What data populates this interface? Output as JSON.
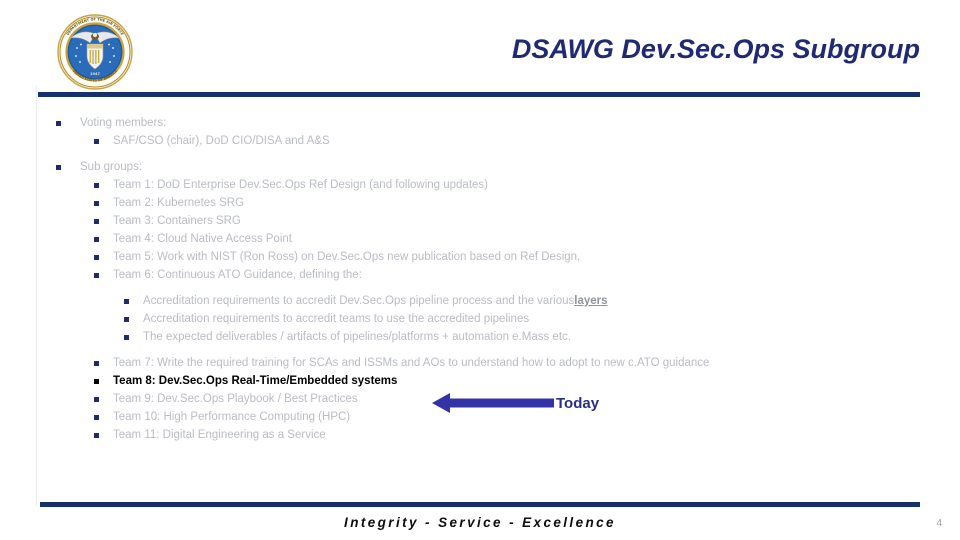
{
  "slide": {
    "title": "DSAWG Dev.Sec.Ops Subgroup",
    "page_number": "4",
    "footer_tagline": "Integrity - Service - Excellence",
    "accent_navy": "#17306e",
    "title_color": "#1f2a72",
    "body_gray": "#b9bcc4",
    "arrow_blue": "#3333a8"
  },
  "seal": {
    "name": "department-of-the-air-force-seal",
    "ring_text_top": "DEPARTMENT OF THE",
    "ring_text_bottom": "AIR FORCE",
    "ring_date": "1947"
  },
  "content": {
    "bullets": [
      {
        "level": 1,
        "text": "Voting members:",
        "style": "normal"
      },
      {
        "level": 2,
        "text": "SAF/CSO (chair), DoD CIO/DISA and A&S",
        "style": "normal"
      },
      {
        "level": 1,
        "text": "Sub groups:",
        "style": "normal"
      },
      {
        "level": 2,
        "text": "Team 1: DoD Enterprise Dev.Sec.Ops Ref Design (and following updates)",
        "style": "normal"
      },
      {
        "level": 2,
        "text": "Team 2: Kubernetes SRG",
        "style": "normal"
      },
      {
        "level": 2,
        "text": "Team 3: Containers SRG",
        "style": "normal"
      },
      {
        "level": 2,
        "text": "Team 4: Cloud Native Access Point",
        "style": "normal"
      },
      {
        "level": 2,
        "text": "Team 5: Work with NIST (Ron Ross) on Dev.Sec.Ops new publication based on Ref Design.",
        "style": "normal"
      },
      {
        "level": 2,
        "text": "Team 6: Continuous ATO Guidance, defining the:",
        "style": "normal"
      },
      {
        "level": 3,
        "text": "Accreditation requirements to accredit Dev.Sec.Ops pipeline process and the various ",
        "emphasis": "layers",
        "style": "normal"
      },
      {
        "level": 3,
        "text": "Accreditation requirements to accredit teams to use the accredited pipelines",
        "style": "normal"
      },
      {
        "level": 3,
        "text": "The expected deliverables / artifacts of pipelines/platforms + automation e.Mass etc.",
        "style": "normal"
      },
      {
        "level": 2,
        "text": "Team 7: Write the required training for SCAs and ISSMs and AOs to understand how to adopt to new c.ATO guidance",
        "style": "normal"
      },
      {
        "level": 2,
        "text": "Team 8: Dev.Sec.Ops Real-Time/Embedded systems",
        "style": "highlight"
      },
      {
        "level": 2,
        "text": "Team 9: Dev.Sec.Ops Playbook / Best Practices",
        "style": "normal"
      },
      {
        "level": 2,
        "text": "Team 10: High Performance Computing (HPC)",
        "style": "normal"
      },
      {
        "level": 2,
        "text": "Team 11: Digital Engineering as a Service",
        "style": "normal"
      }
    ]
  },
  "callout": {
    "label": "Today",
    "arrow_direction": "left",
    "points_to": "Team 8: Dev.Sec.Ops Real-Time/Embedded systems"
  }
}
